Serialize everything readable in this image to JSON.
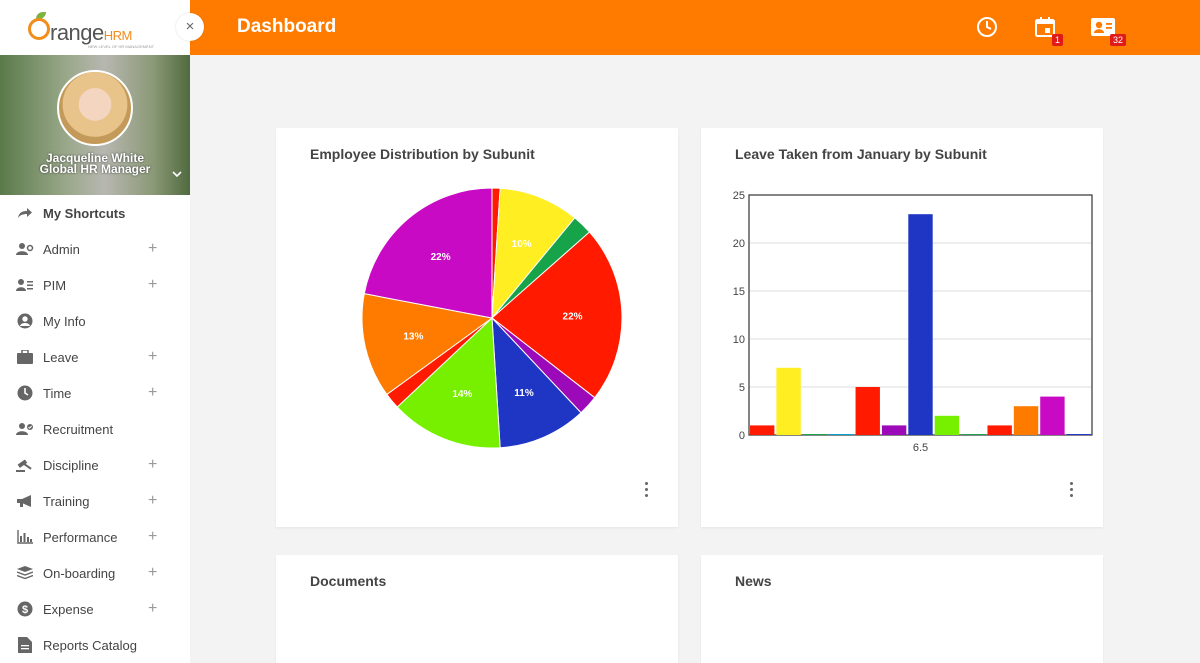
{
  "brand": {
    "orange": "#ff7b00"
  },
  "logo": {
    "name_main": "range",
    "name_hrm": "HRM",
    "tagline": "NEW LEVEL OF HR MANAGEMENT"
  },
  "sidebar": {
    "collapse_icon": "×",
    "user": {
      "name": "Jacqueline White",
      "role": "Global HR Manager"
    },
    "items": [
      {
        "label": "My Shortcuts",
        "icon": "share-arrow-icon",
        "expandable": false
      },
      {
        "label": "Admin",
        "icon": "user-gear-icon",
        "expandable": true
      },
      {
        "label": "PIM",
        "icon": "user-list-icon",
        "expandable": true
      },
      {
        "label": "My Info",
        "icon": "user-circle-icon",
        "expandable": false
      },
      {
        "label": "Leave",
        "icon": "briefcase-icon",
        "expandable": true
      },
      {
        "label": "Time",
        "icon": "clock-icon",
        "expandable": true
      },
      {
        "label": "Recruitment",
        "icon": "user-check-icon",
        "expandable": false
      },
      {
        "label": "Discipline",
        "icon": "gavel-icon",
        "expandable": true
      },
      {
        "label": "Training",
        "icon": "megaphone-icon",
        "expandable": true
      },
      {
        "label": "Performance",
        "icon": "bar-chart-icon",
        "expandable": true
      },
      {
        "label": "On-boarding",
        "icon": "layers-icon",
        "expandable": true
      },
      {
        "label": "Expense",
        "icon": "dollar-icon",
        "expandable": true
      },
      {
        "label": "Reports Catalog",
        "icon": "report-icon",
        "expandable": false
      }
    ]
  },
  "header": {
    "title": "Dashboard",
    "calendar_badge": "1",
    "contacts_badge": "32"
  },
  "cards": {
    "employee_distribution": {
      "title": "Employee Distribution by Subunit"
    },
    "leave_taken": {
      "title": "Leave Taken from January by Subunit"
    },
    "documents": {
      "title": "Documents"
    },
    "news": {
      "title": "News"
    }
  },
  "chart_data": [
    {
      "type": "pie",
      "title": "Employee Distribution by Subunit",
      "slices": [
        {
          "value": 1,
          "color": "#ff1a00",
          "label": ""
        },
        {
          "value": 10,
          "color": "#ffee22",
          "label": "10%"
        },
        {
          "value": 2.5,
          "color": "#16a34a",
          "label": ""
        },
        {
          "value": 22,
          "color": "#ff1a00",
          "label": "22%"
        },
        {
          "value": 2.5,
          "color": "#9c09b8",
          "label": ""
        },
        {
          "value": 11,
          "color": "#1f35c4",
          "label": "11%"
        },
        {
          "value": 14,
          "color": "#77f000",
          "label": "14%"
        },
        {
          "value": 2,
          "color": "#ff1a00",
          "label": ""
        },
        {
          "value": 13,
          "color": "#ff7b00",
          "label": "13%"
        },
        {
          "value": 22,
          "color": "#c80ac4",
          "label": "22%"
        }
      ]
    },
    {
      "type": "bar",
      "title": "Leave Taken from January by Subunit",
      "categories": [
        "6.5"
      ],
      "ylim": [
        0,
        25
      ],
      "yticks": [
        "0",
        "5",
        "10",
        "15",
        "20",
        "25"
      ],
      "bars": [
        {
          "value": 1,
          "color": "#ff1a00"
        },
        {
          "value": 7,
          "color": "#ffee22"
        },
        {
          "value": 0.1,
          "color": "#16a34a"
        },
        {
          "value": 0.1,
          "color": "#00a0d8"
        },
        {
          "value": 5,
          "color": "#ff1a00"
        },
        {
          "value": 1,
          "color": "#9c09b8"
        },
        {
          "value": 23,
          "color": "#1f35c4"
        },
        {
          "value": 2,
          "color": "#77f000"
        },
        {
          "value": 0.1,
          "color": "#16a34a"
        },
        {
          "value": 1,
          "color": "#ff1a00"
        },
        {
          "value": 3,
          "color": "#ff7b00"
        },
        {
          "value": 4,
          "color": "#c80ac4"
        },
        {
          "value": 0.1,
          "color": "#1f35c4"
        }
      ],
      "grid": true
    }
  ]
}
